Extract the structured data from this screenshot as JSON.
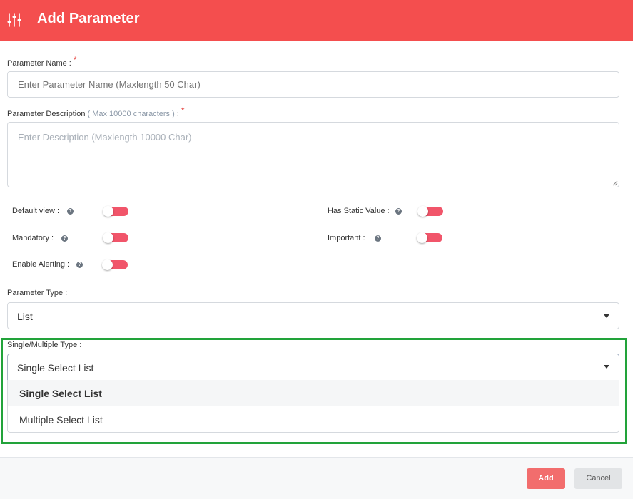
{
  "header": {
    "title": "Add Parameter",
    "icon": "sliders-icon",
    "background": "#f44e4e"
  },
  "form": {
    "name": {
      "label": "Parameter Name :",
      "required_mark": "*",
      "placeholder": "Enter Parameter Name (Maxlength 50 Char)"
    },
    "description": {
      "label": "Parameter Description",
      "hint": "( Max 10000 characters )",
      "label_suffix": ":",
      "required_mark": "*",
      "placeholder": "Enter Description (Maxlength 10000 Char)"
    },
    "toggles": {
      "default_view": {
        "label": "Default view :",
        "enabled": false
      },
      "mandatory": {
        "label": "Mandatory :",
        "enabled": false
      },
      "enable_alerting": {
        "label": "Enable Alerting :",
        "enabled": false
      },
      "has_static_value": {
        "label": "Has Static Value :",
        "enabled": false
      },
      "important": {
        "label": "Important :",
        "enabled": false
      }
    },
    "help_icon_glyph": "?",
    "parameter_type": {
      "label": "Parameter Type :",
      "value": "List"
    },
    "single_multiple_type": {
      "label": "Single/Multiple Type :",
      "value": "Single Select List",
      "options": [
        "Single Select List",
        "Multiple Select List"
      ],
      "highlight_color": "#22a33a"
    }
  },
  "footer": {
    "add_label": "Add",
    "cancel_label": "Cancel",
    "add_color": "#f26d6d",
    "cancel_color": "#e2e4e6"
  }
}
